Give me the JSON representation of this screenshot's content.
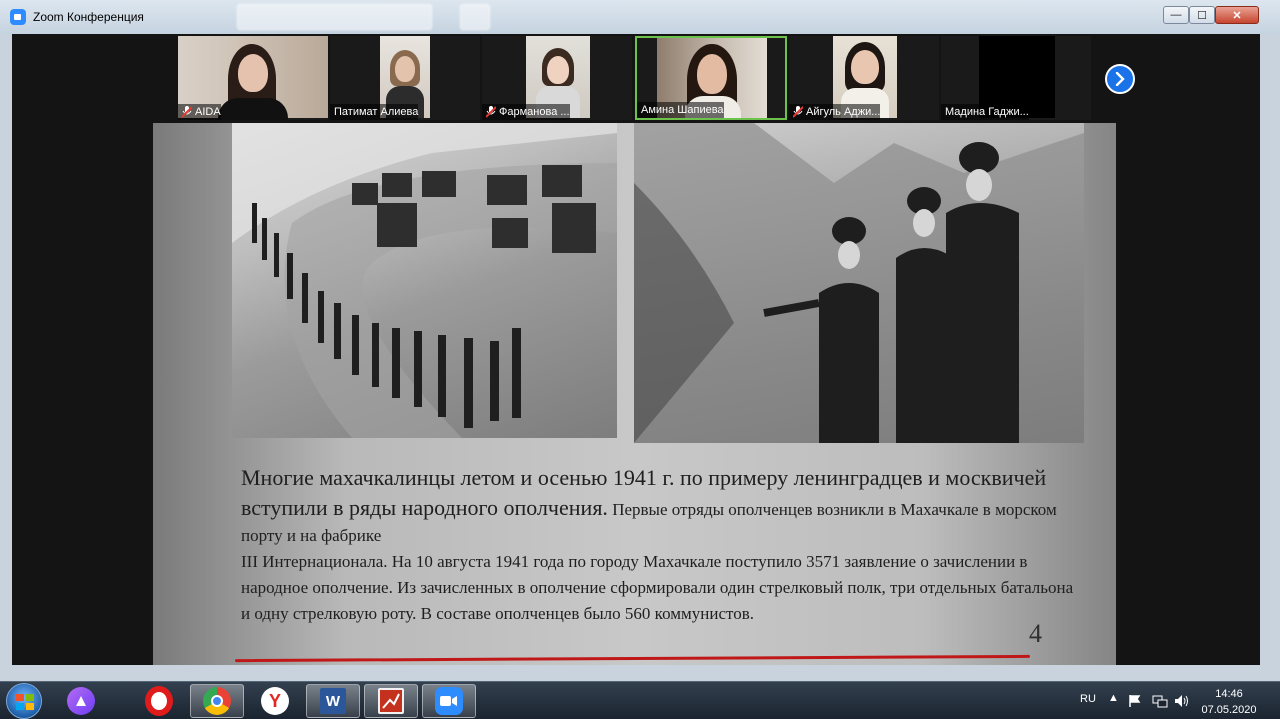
{
  "window": {
    "title": "Zoom Конференция",
    "controls": {
      "minimize": "—",
      "maximize": "☐",
      "close": "✕"
    }
  },
  "participants": [
    {
      "name": "AIDA",
      "muted": true,
      "active": false
    },
    {
      "name": "Патимат Алиева",
      "muted": false,
      "active": false
    },
    {
      "name": "Фарманова ...",
      "muted": true,
      "active": false
    },
    {
      "name": "Амина Шапиева",
      "muted": false,
      "active": true
    },
    {
      "name": "Айгуль Аджи...",
      "muted": true,
      "active": false
    },
    {
      "name": "Мадина Гаджи...",
      "muted": false,
      "active": false
    }
  ],
  "slide": {
    "lead": "Многие махачкалинцы летом и осенью 1941 г. по примеру ленинградцев и москвичей вступили в ряды народного ополчения.",
    "body_1": " Первые отряды ополченцев возникли в Махачкале в морском порту и на фабрике",
    "body_2": "III Интернационала. На 10 августа 1941 года по городу Махачкале поступило 3571 заявление о зачислении в народное ополчение. Из зачисленных в ополчение сформировали один стрелковый полк, три отдельных батальона и одну стрелковую роту. В составе ополченцев было 560 коммунистов.",
    "page_number": "4"
  },
  "taskbar": {
    "apps": [
      "alice-icon",
      "opera-icon",
      "chrome-icon",
      "yandex-icon",
      "word-icon",
      "presentation-icon",
      "zoom-icon"
    ],
    "language": "RU",
    "time": "14:46",
    "date": "07.05.2020"
  },
  "colors": {
    "zoom_blue": "#2d8cff",
    "active_speaker": "#6cc24a",
    "underline": "#c01818"
  }
}
